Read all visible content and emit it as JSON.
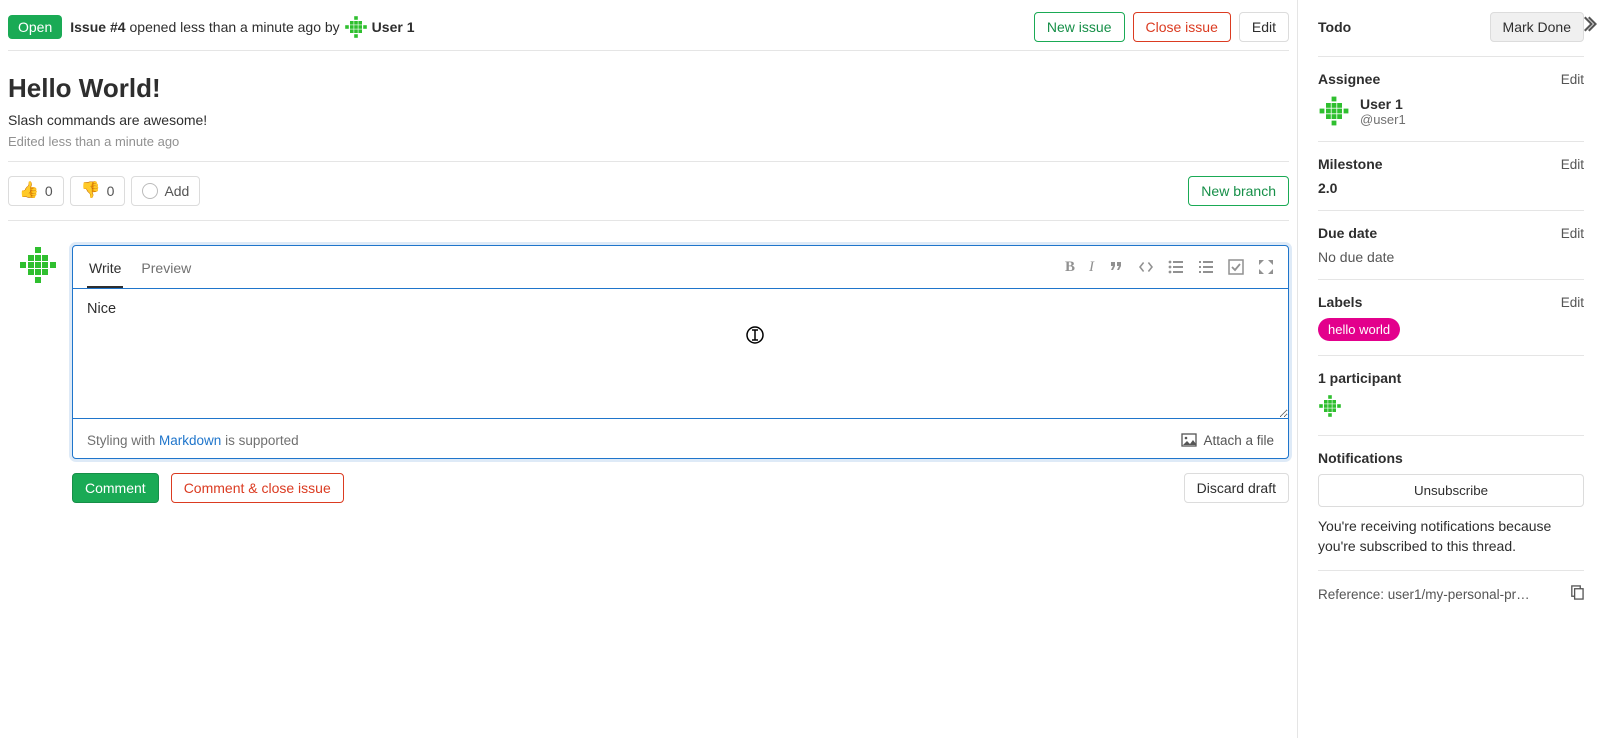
{
  "header": {
    "status_badge": "Open",
    "issue_ref": "Issue #4",
    "opened_text": " opened less than a minute ago by ",
    "author": "User 1",
    "new_issue": "New issue",
    "close_issue": "Close issue",
    "edit": "Edit"
  },
  "issue": {
    "title": "Hello World!",
    "description": "Slash commands are awesome!",
    "edited": "Edited less than a minute ago"
  },
  "reactions": {
    "thumbs_up_count": "0",
    "thumbs_down_count": "0",
    "add_label": "Add",
    "new_branch": "New branch"
  },
  "editor": {
    "write_tab": "Write",
    "preview_tab": "Preview",
    "textarea_value": "Nice",
    "footer_prefix": "Styling with ",
    "footer_link": "Markdown",
    "footer_suffix": " is supported",
    "attach_label": "Attach a file"
  },
  "comment_actions": {
    "comment": "Comment",
    "comment_close": "Comment & close issue",
    "discard": "Discard draft"
  },
  "sidebar": {
    "todo": {
      "title": "Todo",
      "button": "Mark Done"
    },
    "assignee": {
      "title": "Assignee",
      "edit": "Edit",
      "name": "User 1",
      "handle": "@user1"
    },
    "milestone": {
      "title": "Milestone",
      "edit": "Edit",
      "value": "2.0"
    },
    "due_date": {
      "title": "Due date",
      "edit": "Edit",
      "value": "No due date"
    },
    "labels": {
      "title": "Labels",
      "edit": "Edit",
      "chip": "hello world"
    },
    "participants": {
      "title": "1 participant"
    },
    "notifications": {
      "title": "Notifications",
      "unsubscribe": "Unsubscribe",
      "text": "You're receiving notifications because you're subscribed to this thread."
    },
    "reference": {
      "label": "Reference: user1/my-personal-pr…"
    }
  }
}
